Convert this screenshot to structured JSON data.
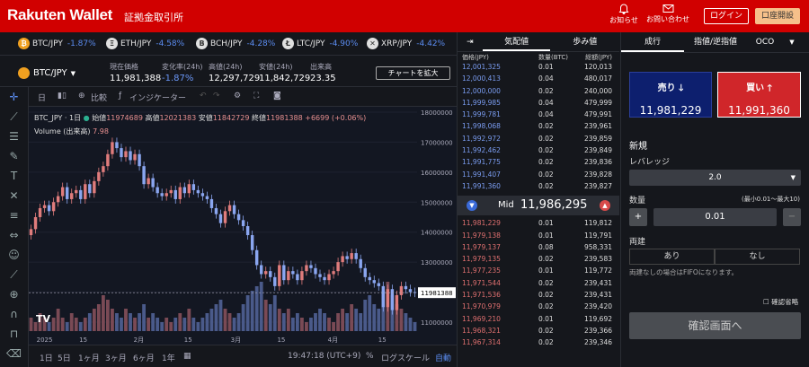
{
  "header": {
    "logo": "Rakuten Wallet",
    "subtitle": "証拠金取引所",
    "notice": "お知らせ",
    "contact": "お問い合わせ",
    "login": "ログイン",
    "open_account": "口座開設"
  },
  "ticker": [
    {
      "pair": "BTC/JPY",
      "change": "-1.87%",
      "symbol": "₿"
    },
    {
      "pair": "ETH/JPY",
      "change": "-4.58%",
      "symbol": "Ξ"
    },
    {
      "pair": "BCH/JPY",
      "change": "-4.28%",
      "symbol": "B"
    },
    {
      "pair": "LTC/JPY",
      "change": "-4.90%",
      "symbol": "Ł"
    },
    {
      "pair": "XRP/JPY",
      "change": "-4.42%",
      "symbol": "✕"
    }
  ],
  "info": {
    "symbol": "BTC/JPY",
    "current_label": "現在価格",
    "current": "11,981,388",
    "change_label": "変化率(24h)",
    "change": "-1.87%",
    "high_label": "高値(24h)",
    "high": "12,297,729",
    "low_label": "安値(24h)",
    "low": "11,842,729",
    "volume_label": "出来高",
    "volume": "23.35",
    "expand": "チャートを拡大"
  },
  "chart_toolbar": {
    "interval": "日",
    "compare": "比較",
    "indicator": "インジケーター"
  },
  "chart_legend": {
    "title": "BTC_JPY · 1日",
    "open_label": "始値",
    "open": "11974689",
    "high_label": "高値",
    "high": "12021383",
    "low_label": "安値",
    "low": "11842729",
    "close_label": "終値",
    "close": "11981388",
    "change": "+6699 (+0.06%)",
    "volume_label": "Volume (出来高)",
    "volume": "7.98"
  },
  "chart_data": {
    "type": "candlestick",
    "y_ticks": [
      "18000000",
      "17000000",
      "16000000",
      "15000000",
      "14000000",
      "13000000",
      "12000000",
      "11000000"
    ],
    "x_ticks": [
      "2025",
      "15",
      "2月",
      "15",
      "3月",
      "15",
      "4月",
      "15"
    ],
    "ylim": [
      10700000,
      18000000
    ],
    "last_price_label": "11981388",
    "closes": [
      14100000,
      14500000,
      14800000,
      14900000,
      14700000,
      15000000,
      15200000,
      15500000,
      15100000,
      15300000,
      15400000,
      15100000,
      15600000,
      15300000,
      15700000,
      16000000,
      16200000,
      16600000,
      17000000,
      16800000,
      16500000,
      16700000,
      16400000,
      16600000,
      16200000,
      15600000,
      15800000,
      15500000,
      15300000,
      15200000,
      15300000,
      15400000,
      15100000,
      15500000,
      15300000,
      15600000,
      15400000,
      15300000,
      15200000,
      15100000,
      14800000,
      14600000,
      14300000,
      14700000,
      14900000,
      14600000,
      14400000,
      14200000,
      13900000,
      13400000,
      12900000,
      12600000,
      12700000,
      12500000,
      12200000,
      12900000,
      12400000,
      12700000,
      12600000,
      12400000,
      12700000,
      12900000,
      12800000,
      12600000,
      12500000,
      12400000,
      12600000,
      12700000,
      13000000,
      13200000,
      13100000,
      13300000,
      13100000,
      12800000,
      12500000,
      12400000,
      12300000,
      12200000,
      11500000,
      12100000,
      11400000,
      11900000,
      12200000,
      12100000,
      12000000,
      11981388
    ],
    "volumes": [
      3,
      2,
      4,
      3,
      2,
      3,
      5,
      3,
      2,
      4,
      3,
      2,
      3,
      4,
      5,
      6,
      8,
      7,
      5,
      4,
      3,
      5,
      4,
      3,
      4,
      6,
      3,
      4,
      3,
      2,
      3,
      2,
      3,
      4,
      3,
      5,
      3,
      2,
      3,
      4,
      5,
      6,
      7,
      5,
      4,
      3,
      4,
      6,
      8,
      9,
      10,
      11,
      7,
      6,
      8,
      5,
      4,
      5,
      3,
      4,
      3,
      2,
      3,
      4,
      5,
      4,
      3,
      2,
      4,
      5,
      4,
      6,
      5,
      4,
      7,
      8,
      6,
      5,
      9,
      11,
      8,
      6,
      5,
      4,
      3,
      2
    ]
  },
  "bottom_toolbar": {
    "ranges": [
      "1日",
      "5日",
      "1ヶ月",
      "3ヶ月",
      "6ヶ月",
      "1年"
    ],
    "time": "19:47:18 (UTC+9)",
    "percent": "%",
    "log": "ログスケール",
    "auto": "自動"
  },
  "orderbook": {
    "tab_quote": "気配値",
    "tab_trades": "歩み値",
    "headers": [
      "価格(JPY)",
      "数量(BTC)",
      "総額(JPY)"
    ],
    "asks": [
      [
        "12,001,325",
        "0.01",
        "120,013"
      ],
      [
        "12,000,413",
        "0.04",
        "480,017"
      ],
      [
        "12,000,000",
        "0.02",
        "240,000"
      ],
      [
        "11,999,985",
        "0.04",
        "479,999"
      ],
      [
        "11,999,781",
        "0.04",
        "479,991"
      ],
      [
        "11,998,068",
        "0.02",
        "239,961"
      ],
      [
        "11,992,972",
        "0.02",
        "239,859"
      ],
      [
        "11,992,462",
        "0.02",
        "239,849"
      ],
      [
        "11,991,775",
        "0.02",
        "239,836"
      ],
      [
        "11,991,407",
        "0.02",
        "239,828"
      ],
      [
        "11,991,360",
        "0.02",
        "239,827"
      ]
    ],
    "mid_label": "Mid",
    "mid": "11,986,295",
    "bids": [
      [
        "11,981,229",
        "0.01",
        "119,812"
      ],
      [
        "11,979,138",
        "0.01",
        "119,791"
      ],
      [
        "11,979,137",
        "0.08",
        "958,331"
      ],
      [
        "11,979,135",
        "0.02",
        "239,583"
      ],
      [
        "11,977,235",
        "0.01",
        "119,772"
      ],
      [
        "11,971,544",
        "0.02",
        "239,431"
      ],
      [
        "11,971,536",
        "0.02",
        "239,431"
      ],
      [
        "11,970,979",
        "0.02",
        "239,420"
      ],
      [
        "11,969,210",
        "0.01",
        "119,692"
      ],
      [
        "11,968,321",
        "0.02",
        "239,366"
      ],
      [
        "11,967,314",
        "0.02",
        "239,346"
      ]
    ]
  },
  "order_form": {
    "tabs": [
      "成行",
      "指値/逆指値",
      "OCO"
    ],
    "sell_label": "売り",
    "sell_price": "11,981,229",
    "buy_label": "買い",
    "buy_price": "11,991,360",
    "section": "新規",
    "leverage_label": "レバレッジ",
    "leverage": "2.0",
    "qty_label": "数量",
    "qty_range": "(最小0.01〜最大10)",
    "qty": "0.01",
    "both_label": "両建",
    "yes": "あり",
    "no": "なし",
    "note": "両建なしの場合はFIFOになります。",
    "skip_confirm": "確認省略",
    "confirm": "確認画面へ"
  }
}
